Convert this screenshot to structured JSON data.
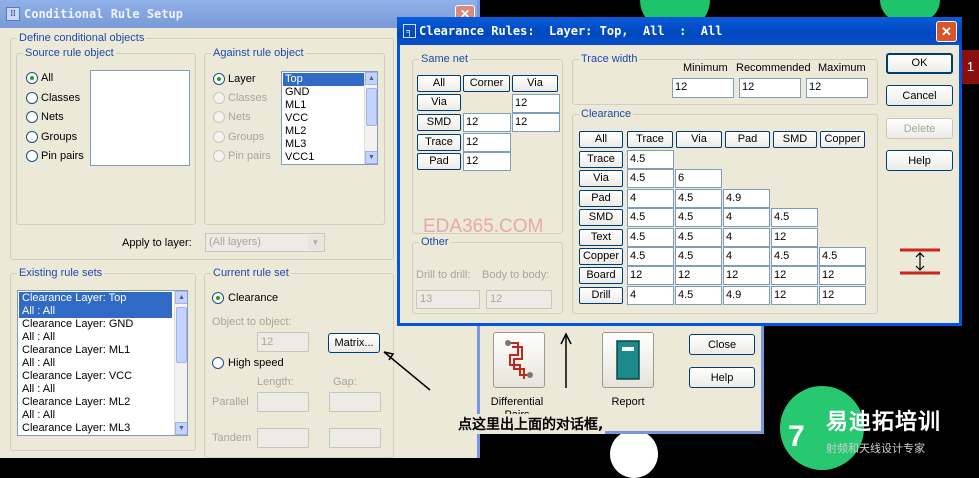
{
  "cond": {
    "title": "Conditional Rule Setup",
    "define_legend": "Define conditional objects",
    "source_legend": "Source rule object",
    "source_options": [
      "All",
      "Classes",
      "Nets",
      "Groups",
      "Pin pairs"
    ],
    "against_legend": "Against rule object",
    "against_options": [
      "Layer",
      "Classes",
      "Nets",
      "Groups",
      "Pin pairs"
    ],
    "layer_list": [
      "Top",
      "GND",
      "ML1",
      "VCC",
      "ML2",
      "ML3",
      "VCC1"
    ],
    "apply_label": "Apply to layer:",
    "apply_value": "(All layers)",
    "existing_legend": "Existing rule sets",
    "rule_sets": [
      [
        "Clearance  Layer: Top",
        "All  :  All"
      ],
      [
        "Clearance  Layer: GND",
        "All  :  All"
      ],
      [
        "Clearance  Layer: ML1",
        "All  :  All"
      ],
      [
        "Clearance  Layer: VCC",
        "All  :  All"
      ],
      [
        "Clearance  Layer: ML2",
        "All  :  All"
      ],
      [
        "Clearance  Layer: ML3",
        ""
      ]
    ],
    "current_legend": "Current rule set",
    "clearance_label": "Clearance",
    "obj_label": "Object to object:",
    "obj_value": "12",
    "matrix_btn": "Matrix...",
    "high_speed_label": "High speed",
    "length_label": "Length:",
    "gap_label": "Gap:",
    "parallel_label": "Parallel",
    "tandem_label": "Tandem",
    "diff_label": "Differential Pairs",
    "report_label": "Report",
    "close_btn": "Close",
    "help_btn": "Help"
  },
  "clr": {
    "title": "Clearance Rules:  Layer: Top,  All  :  All",
    "same_net_legend": "Same net",
    "same_net_headers": [
      "All",
      "Corner",
      "Via"
    ],
    "same_net_rows": [
      {
        "label": "Via",
        "cells": [
          "",
          "12"
        ]
      },
      {
        "label": "SMD",
        "cells": [
          "12",
          "12"
        ]
      },
      {
        "label": "Trace",
        "cells": [
          "12"
        ]
      },
      {
        "label": "Pad",
        "cells": [
          "12"
        ]
      }
    ],
    "trace_width_legend": "Trace width",
    "tw_headers": [
      "Minimum",
      "Recommended",
      "Maximum"
    ],
    "tw_values": [
      "12",
      "12",
      "12"
    ],
    "clearance_legend": "Clearance",
    "cl_headers": [
      "All",
      "Trace",
      "Via",
      "Pad",
      "SMD",
      "Copper"
    ],
    "cl_rows": [
      {
        "label": "Trace",
        "cells": [
          "4.5"
        ]
      },
      {
        "label": "Via",
        "cells": [
          "4.5",
          "6"
        ]
      },
      {
        "label": "Pad",
        "cells": [
          "4",
          "4.5",
          "4.9"
        ]
      },
      {
        "label": "SMD",
        "cells": [
          "4.5",
          "4.5",
          "4",
          "4.5"
        ]
      },
      {
        "label": "Text",
        "cells": [
          "4.5",
          "4.5",
          "4",
          "12"
        ]
      },
      {
        "label": "Copper",
        "cells": [
          "4.5",
          "4.5",
          "4",
          "4.5",
          "4.5"
        ]
      },
      {
        "label": "Board",
        "cells": [
          "12",
          "12",
          "12",
          "12",
          "12"
        ]
      },
      {
        "label": "Drill",
        "cells": [
          "4",
          "4.5",
          "4.9",
          "12",
          "12"
        ]
      }
    ],
    "other_legend": "Other",
    "drill_label": "Drill to drill:",
    "drill_value": "13",
    "body_label": "Body to body:",
    "body_value": "12",
    "ok_btn": "OK",
    "cancel_btn": "Cancel",
    "delete_btn": "Delete",
    "help_btn": "Help",
    "watermark": "EDA365.COM"
  },
  "annotation": "点这里出上面的对话框,",
  "pcb": {
    "marker": "1",
    "pad_number": "7",
    "logo_text": "易迪拓培训",
    "logo_sub": "射频和天线设计专家"
  }
}
